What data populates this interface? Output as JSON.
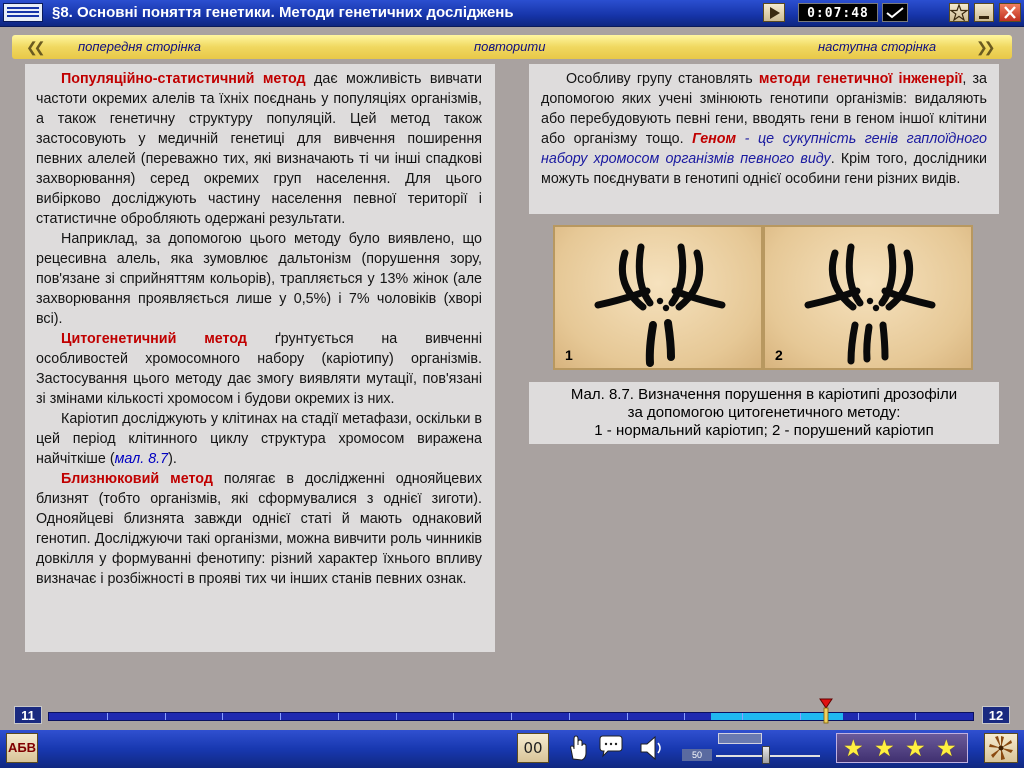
{
  "window": {
    "title": "§8. Основні поняття генетики. Методи генетичних досліджень",
    "timer": "0:07:48"
  },
  "nav": {
    "prev": "попередня сторінка",
    "repeat": "повторити",
    "next": "наступна сторінка"
  },
  "left": {
    "p1_term": "Популяційно-статистичний метод",
    "p1_rest": " дає можливість вивчати частоти окремих алелів та їхніх поєднань у популяціях організмів, а також генетичну структуру популяцій. Цей метод також застосовують у медичній генетиці для вивчення поширення певних алелей (переважно тих, які визначають ті чи інші спадкові захворювання) серед окремих груп населення. Для цього вибірково досліджують частину населення певної території і статистичне обробляють одержані результати.",
    "p2": "Наприклад, за допомогою цього методу було виявлено, що рецесивна алель, яка зумовлює дальтонізм (порушення зору, пов'язане зі сприйняттям кольорів), трапляється у 13% жінок (але захворювання проявляється лише у 0,5%) і 7% чоловіків (хворі всі).",
    "p3_term": "Цитогенетичний метод",
    "p3_rest": " ґрунтується на вивченні особливостей хромосомного набору (каріотипу) організмів. Застосування цього методу дає змогу виявляти мутації, пов'язані зі змінами кількості хромосом і будови окремих із них.",
    "p4_start": "Каріотип досліджують у клітинах на стадії метафази, оскільки в цей період клітинного циклу структура хромосом виражена найчіткіше (",
    "p4_ref": "мал. 8.7",
    "p4_end": ").",
    "p5_term": "Близнюковий метод",
    "p5_rest": " полягає в дослідженні однояйцевих близнят (тобто організмів, які сформувалися з однієї зиготи). Однояйцеві близнята завжди однієї статі й мають однаковий генотип. Досліджуючи такі організми, можна вивчити роль чинників довкілля у формуванні фенотипу: різний характер їхнього впливу визначає і розбіжності в прояві тих чи інших станів певних ознак."
  },
  "right": {
    "start": "Особливу групу становлять ",
    "term": "методи генетичної інженерії",
    "mid": ", за допомогою яких учені змінюють генотипи організмів: видаляють або перебудовують певні гени, вводять гени в геном іншої клітини або організму тощо. ",
    "genom": "Геном",
    "def": " - це сукупність генів гаплоїдного набору хромосом організмів певного виду",
    "end": ". Крім того, дослідники можуть поєднувати в генотипі однієї особини гени різних видів."
  },
  "figure": {
    "label_1": "1",
    "label_2": "2",
    "caption_line1": "Мал. 8.7. Визначення порушення в каріотипі дрозофіли",
    "caption_line2": "за допомогою цитогенетичного методу:",
    "caption_line3": "1 - нормальний каріотип; 2 - порушений каріотип"
  },
  "progress": {
    "current_page": "11",
    "next_page": "12",
    "position_fraction": 0.84
  },
  "footer": {
    "abc": "АБВ",
    "counter": "00",
    "volume": "50",
    "rating_stars": 4
  },
  "icons": {
    "menu": "menu-icon",
    "play": "play-icon",
    "check": "check-icon",
    "favorite": "star-icon",
    "minimize": "minimize-icon",
    "close": "close-icon",
    "hand": "hand-icon",
    "comment": "comment-icon",
    "speaker": "speaker-icon",
    "fan": "fan-icon"
  },
  "colors": {
    "title_bar": "#1634a8",
    "nav_bar": "#f0d860",
    "term_red": "#c00000",
    "link_blue": "#0000c0",
    "panel": "#dedcdc",
    "background": "#a9a2a0"
  }
}
